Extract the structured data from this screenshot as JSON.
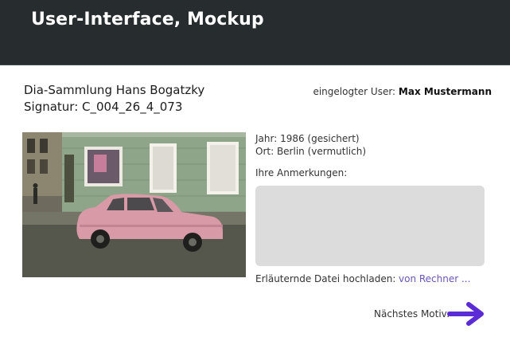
{
  "header": {
    "title": "User-Interface, Mockup"
  },
  "record": {
    "collection": "Dia-Sammlung Hans Bogatzky",
    "signature": "Signatur: C_004_26_4_073"
  },
  "user": {
    "prefix": "eingelogter User:",
    "name": "Max Mustermann"
  },
  "meta": {
    "year": "Jahr: 1986 (gesichert)",
    "place": "Ort: Berlin (vermutlich)"
  },
  "notes": {
    "label": "Ihre Anmerkungen:",
    "value": ""
  },
  "upload": {
    "label": "Erläuternde Datei hochladen:",
    "link": "von Rechner ..."
  },
  "navigation": {
    "next_label": "Nächstes Motiv:",
    "next_icon": "arrow-right-icon"
  },
  "colors": {
    "header_bg": "#272c2e",
    "accent": "#5b2bd6",
    "link": "#6a55b8",
    "notes_bg": "#dcdcdc"
  }
}
